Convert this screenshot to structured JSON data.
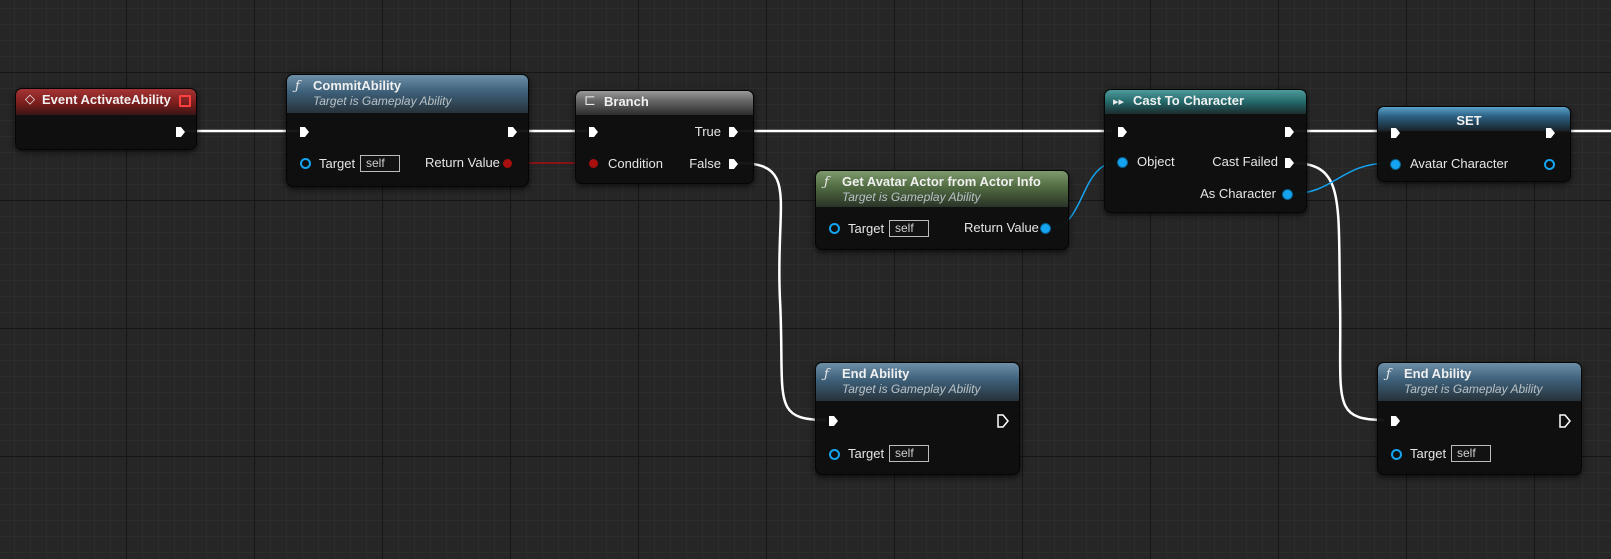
{
  "colors": {
    "exec_wire": "#ffffff",
    "object_wire": "#14a4f0",
    "bool_wire": "#a80f0f",
    "function_header": "#3d5f78",
    "pure_function_header": "#506b42",
    "event_header": "#7a1d1d"
  },
  "nodes": {
    "event_activate": {
      "title": "Event ActivateAbility",
      "icon": "event-diamond-icon"
    },
    "commit_ability": {
      "title": "CommitAbility",
      "subtitle": "Target is Gameplay Ability",
      "target_label": "Target",
      "target_value": "self",
      "return_label": "Return Value",
      "icon": "function-icon"
    },
    "branch": {
      "title": "Branch",
      "true_label": "True",
      "false_label": "False",
      "condition_label": "Condition",
      "icon": "branch-icon"
    },
    "get_avatar": {
      "title": "Get Avatar Actor from Actor Info",
      "subtitle": "Target is Gameplay Ability",
      "target_label": "Target",
      "target_value": "self",
      "return_label": "Return Value",
      "icon": "function-icon"
    },
    "cast": {
      "title": "Cast To Character",
      "object_label": "Object",
      "cast_failed_label": "Cast Failed",
      "as_label": "As Character",
      "icon": "cast-icon"
    },
    "set": {
      "title": "SET",
      "var_label": "Avatar Character"
    },
    "end_ability_1": {
      "title": "End Ability",
      "subtitle": "Target is Gameplay Ability",
      "target_label": "Target",
      "target_value": "self",
      "icon": "function-icon"
    },
    "end_ability_2": {
      "title": "End Ability",
      "subtitle": "Target is Gameplay Ability",
      "target_label": "Target",
      "target_value": "self",
      "icon": "function-icon"
    }
  }
}
